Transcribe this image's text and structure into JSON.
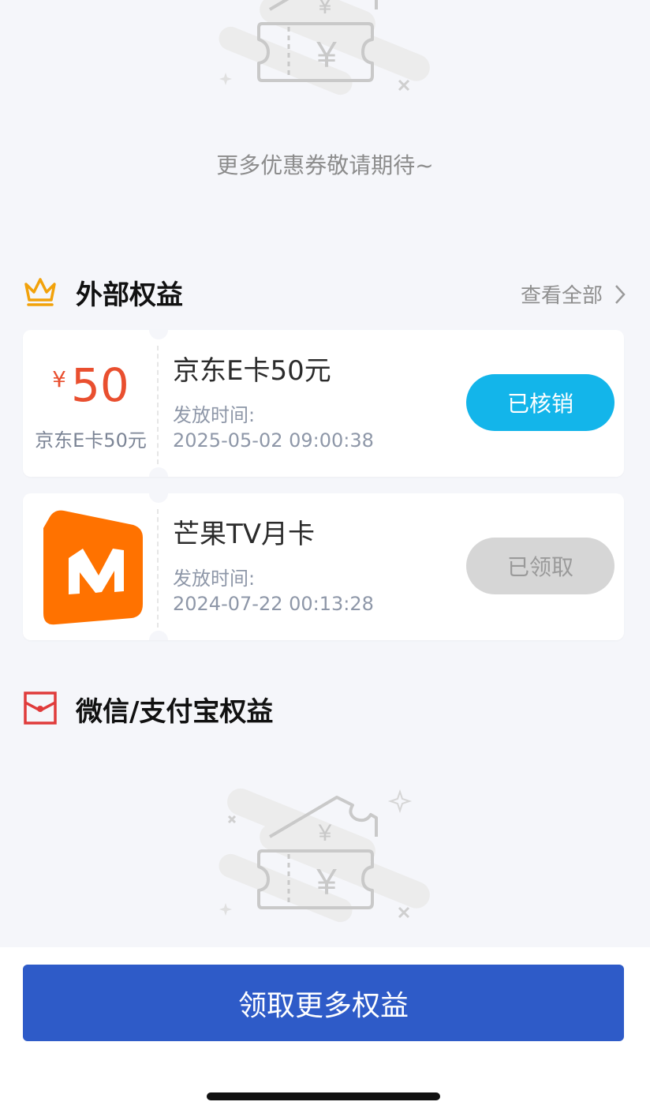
{
  "empty_state": {
    "message": "更多优惠券敬请期待~"
  },
  "external_benefits": {
    "title": "外部权益",
    "see_all": "查看全部",
    "crown_icon": "crown-icon",
    "accent": "#f2a20b",
    "items": [
      {
        "currency": "¥",
        "amount": "50",
        "left_label": "京东E卡50元",
        "title": "京东E卡50元",
        "time_label": "发放时间:",
        "time_value": "2025-05-02 09:00:38",
        "status": "已核销",
        "status_color": "#13b5ea"
      },
      {
        "logo": "mango-tv-logo",
        "title": "芒果TV月卡",
        "time_label": "发放时间:",
        "time_value": "2024-07-22 00:13:28",
        "status": "已领取",
        "status_color": "#d6d6d6"
      }
    ]
  },
  "wechat_alipay_benefits": {
    "title": "微信/支付宝权益",
    "icon": "red-envelope-icon"
  },
  "footer": {
    "cta": "领取更多权益",
    "cta_color": "#2e5bc8"
  }
}
